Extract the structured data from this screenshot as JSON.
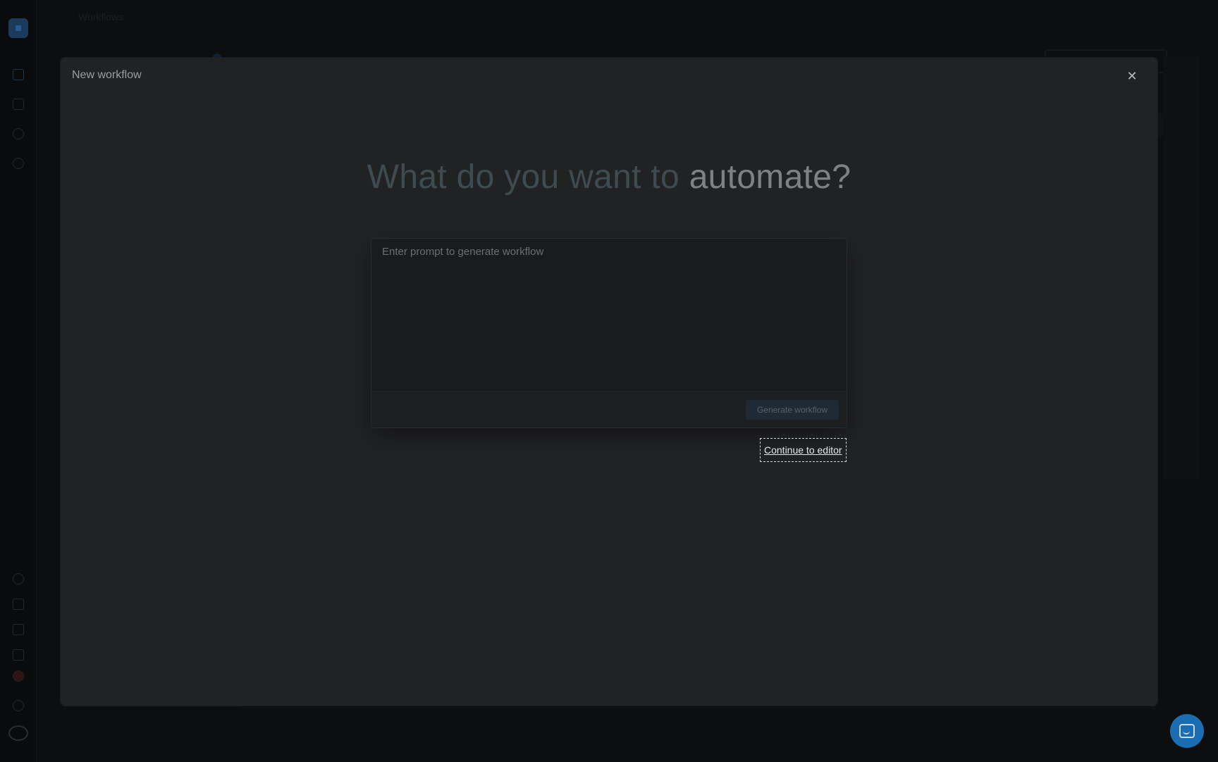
{
  "background": {
    "page_title": "Workflows"
  },
  "modal": {
    "title": "New workflow",
    "close_icon": "close-icon",
    "headline_part1": "What do you want to ",
    "headline_part2": "automate?",
    "prompt_placeholder": "Enter prompt to generate workflow",
    "prompt_value": "",
    "generate_button": "Generate workflow",
    "continue_link": "Continue to editor"
  },
  "chat": {
    "icon": "chat-bubble-icon"
  },
  "colors": {
    "accent": "#1a6db1",
    "modal_bg": "#212224",
    "headline_muted": "#3e4c51",
    "headline_gray": "#7e8286"
  }
}
